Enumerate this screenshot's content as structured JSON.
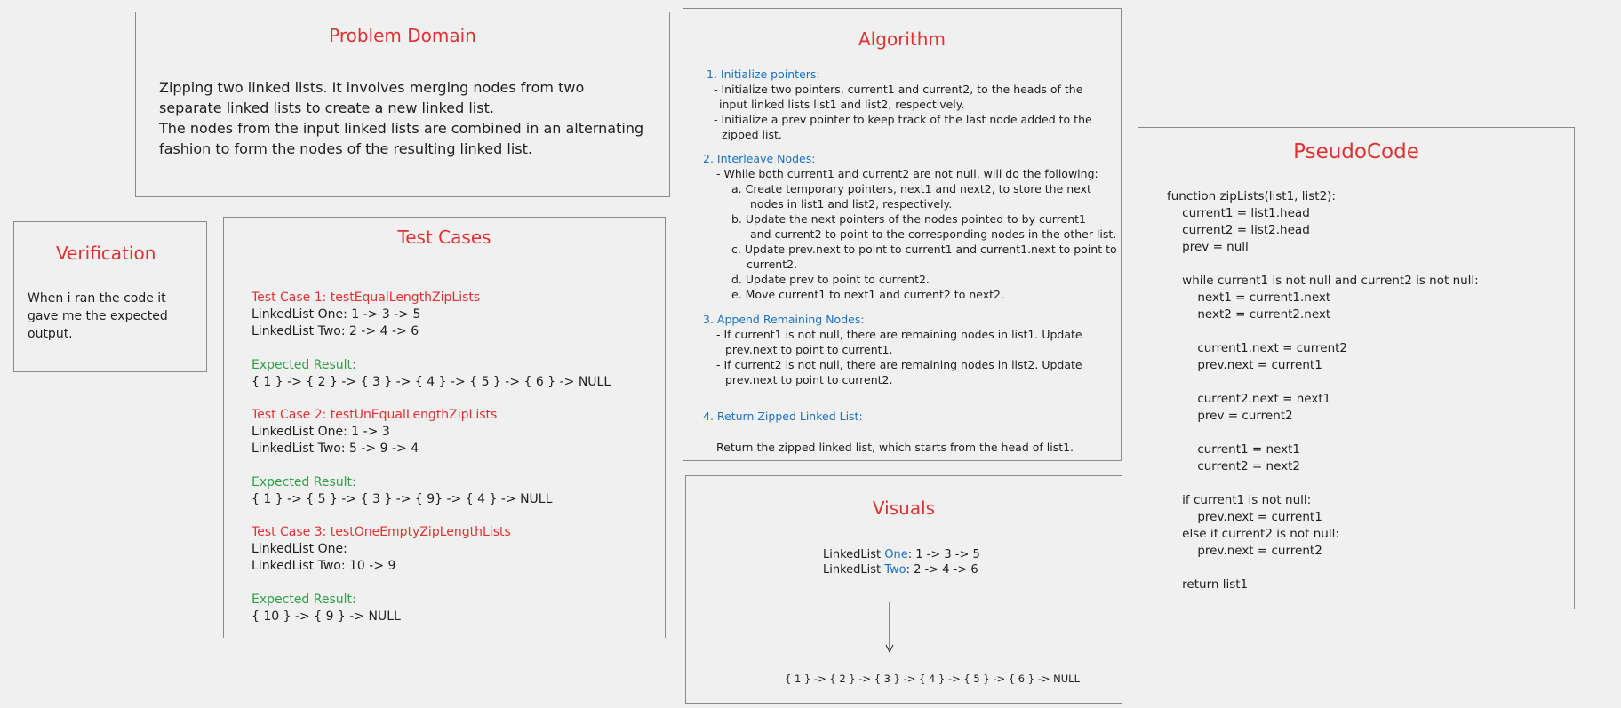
{
  "problem_domain": {
    "title": "Problem Domain",
    "lines": [
      "Zipping two linked lists. It involves merging nodes from two",
      "separate linked lists to create a new linked list.",
      "The nodes from the input linked lists are combined in an alternating",
      "fashion to form the nodes of the resulting linked list."
    ]
  },
  "verification": {
    "title": "Verification",
    "lines": [
      "When i ran the code it",
      "gave me the expected",
      "output."
    ]
  },
  "test_cases": {
    "title": "Test Cases",
    "cases": [
      {
        "name": "Test Case 1:  testEqualLengthZipLists",
        "list_one": "LinkedList One: 1 -> 3 -> 5",
        "list_two": "LinkedList Two: 2 -> 4 -> 6",
        "expected_label": "Expected Result:",
        "expected": "{ 1 } -> { 2 } -> { 3 } -> { 4 } -> { 5 } -> { 6 } -> NULL"
      },
      {
        "name": "Test Case 2: testUnEqualLengthZipLists",
        "list_one": "LinkedList One: 1 -> 3",
        "list_two": "LinkedList Two: 5 -> 9 -> 4",
        "expected_label": "Expected Result:",
        "expected": "{ 1 } -> { 5 } -> { 3 } -> { 9} -> { 4 } -> NULL"
      },
      {
        "name": "Test Case 3: testOneEmptyZipLengthLists",
        "list_one": "LinkedList One:",
        "list_two": "LinkedList Two: 10 -> 9",
        "expected_label": "Expected Result:",
        "expected": "{ 10 } -> { 9 } -> NULL"
      }
    ]
  },
  "algorithm": {
    "title": "Algorithm",
    "step1": "1.  Initialize pointers:",
    "step1_lines": [
      "- Initialize two pointers, current1 and current2, to the heads of the",
      "input linked lists list1 and list2, respectively.",
      "- Initialize a prev pointer to keep track of the last node added to the",
      "zipped list."
    ],
    "step2": "2. Interleave Nodes:",
    "step2_lines": [
      "- While both current1 and current2 are not null, will do the following:",
      "a.  Create temporary pointers, next1 and next2, to store the next",
      "nodes in list1 and list2, respectively.",
      "b.  Update the next pointers of the nodes pointed to by current1",
      "and current2 to point to the corresponding nodes in the other list.",
      "c.  Update prev.next to point to current1 and current1.next to point to",
      "current2.",
      "d.  Update prev to point to current2.",
      "e.  Move current1 to next1 and current2 to next2."
    ],
    "step3": "3.  Append Remaining Nodes:",
    "step3_lines": [
      "- If current1 is not null, there are remaining nodes in list1. Update",
      "prev.next to point to current1.",
      "- If current2 is not null, there are remaining nodes in list2. Update",
      "prev.next to point to current2."
    ],
    "step4": "4.  Return Zipped Linked List:",
    "step4_line": "Return the zipped linked list, which starts from the head of list1."
  },
  "visuals": {
    "title": "Visuals",
    "one_prefix": "LinkedList ",
    "one_word": "One",
    "one_suffix": ": 1 -> 3 -> 5",
    "two_prefix": "LinkedList ",
    "two_word": "Two",
    "two_suffix": ": 2 -> 4 -> 6",
    "result": "{ 1 } -> { 2 } -> { 3 } -> { 4 } -> { 5 } -> { 6 } -> NULL"
  },
  "pseudocode": {
    "title": "PseudoCode",
    "lines": [
      "function zipLists(list1, list2):",
      "    current1 = list1.head",
      "    current2 = list2.head",
      "    prev = null",
      "",
      "    while current1 is not null and current2 is not null:",
      "        next1 = current1.next",
      "        next2 = current2.next",
      "",
      "        current1.next = current2",
      "        prev.next = current1",
      "",
      "        current2.next = next1",
      "        prev = current2",
      "",
      "        current1 = next1",
      "        current2 = next2",
      "",
      "    if current1 is not null:",
      "        prev.next = current1",
      "    else if current2 is not null:",
      "        prev.next = current2",
      "",
      "    return list1"
    ]
  }
}
